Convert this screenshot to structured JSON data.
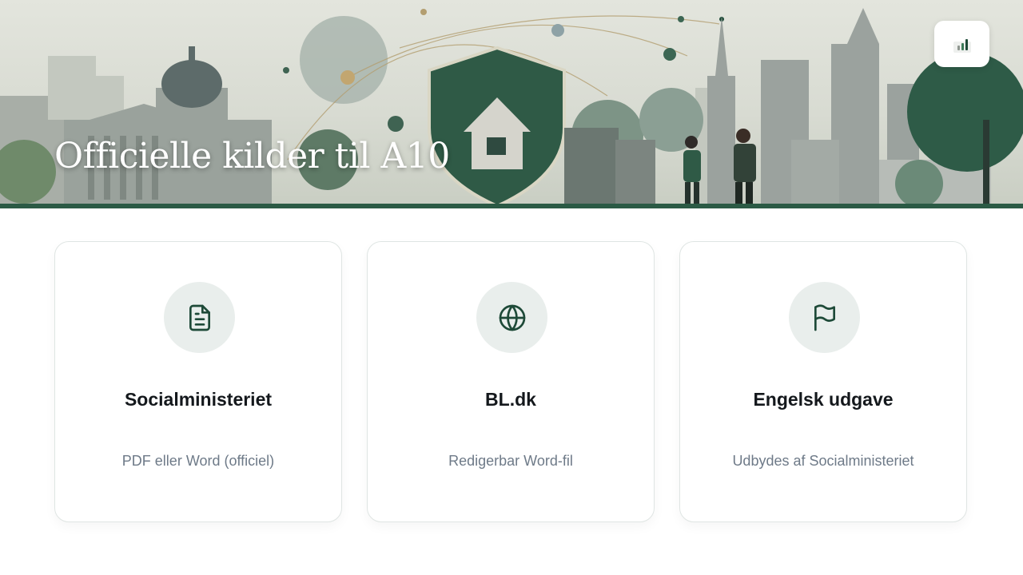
{
  "hero": {
    "title": "Officielle kilder til A10",
    "stats_icon": "bar-chart-icon"
  },
  "cards": [
    {
      "title": "Socialministeriet",
      "subtitle": "PDF eller Word (officiel)",
      "icon": "document-icon"
    },
    {
      "title": "BL.dk",
      "subtitle": "Redigerbar Word-fil",
      "icon": "globe-icon"
    },
    {
      "title": "Engelsk udgave",
      "subtitle": "Udbydes af Socialministeriet",
      "icon": "flag-icon"
    }
  ],
  "colors": {
    "accent": "#1e4a38",
    "icon_bg": "#e9eeec",
    "subtitle": "#6e7a88"
  }
}
